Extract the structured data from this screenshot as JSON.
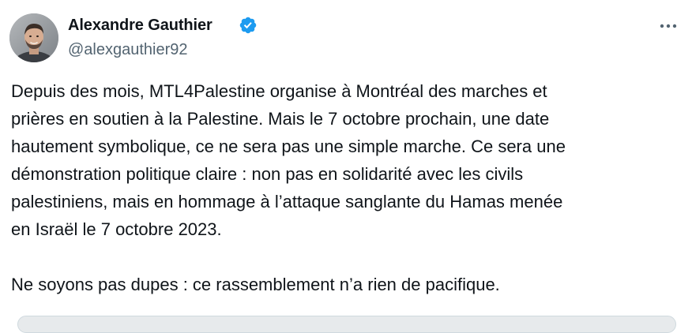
{
  "author": {
    "name": "Alexandre Gauthier",
    "handle": "@alexgauthier92",
    "avatar_icon": "profile-photo",
    "verified_icon": "verified-badge-icon",
    "verified_color": "#1d9bf0"
  },
  "more_icon": "more-horizontal-icon",
  "tweet": {
    "lines": [
      "Depuis des mois, MTL4Palestine organise à Montréal des marches et",
      "prières en soutien à la Palestine. Mais le 7 octobre prochain, une date",
      "hautement symbolique, ce ne sera pas une simple marche. Ce sera une",
      "démonstration politique claire : non pas en solidarité avec les civils",
      "palestiniens, mais en hommage à l’attaque sanglante du Hamas menée",
      "en Israël le 7 octobre 2023."
    ],
    "closing": "Ne soyons pas dupes : ce rassemblement n’a rien de pacifique."
  },
  "colors": {
    "text": "#0f1419",
    "secondary_text": "#536471",
    "accent": "#1d9bf0"
  }
}
